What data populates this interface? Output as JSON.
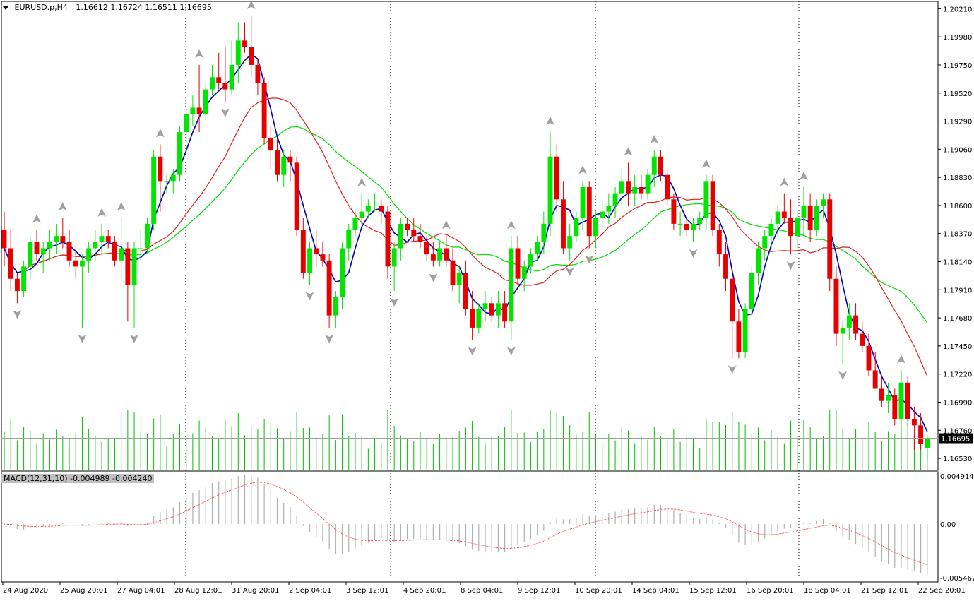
{
  "window": {
    "symbol": "EURUSD.p,H4",
    "ohlc": "1.16612 1.16724 1.16511 1.16695",
    "current_price_label": "1.16695"
  },
  "colors": {
    "bull": "#00e600",
    "bear": "#e60000",
    "fast_ma": "#0000b4",
    "slow_ma": "#e02020",
    "ma_green": "#00dd00",
    "volume": "#00c000",
    "fractal": "#a0a0a0",
    "macd_hist": "#b0b0b0",
    "macd_signal": "#ff3030"
  },
  "price_axis": {
    "ticks": [
      "1.20210",
      "1.19980",
      "1.19750",
      "1.19520",
      "1.19290",
      "1.19060",
      "1.18830",
      "1.18600",
      "1.18370",
      "1.18140",
      "1.17910",
      "1.17680",
      "1.17450",
      "1.17220",
      "1.16990",
      "1.16760",
      "1.16530"
    ]
  },
  "time_axis": {
    "labels": [
      "24 Aug 2020",
      "25 Aug 20:01",
      "27 Aug 04:01",
      "28 Aug 12:01",
      "31 Aug 20:01",
      "2 Sep 04:01",
      "3 Sep 12:01",
      "4 Sep 20:01",
      "8 Sep 04:01",
      "9 Sep 12:01",
      "10 Sep 20:01",
      "14 Sep 04:01",
      "15 Sep 12:01",
      "16 Sep 20:01",
      "18 Sep 04:01",
      "21 Sep 12:01",
      "22 Sep 20:01"
    ]
  },
  "macd": {
    "label": "MACD(12,31,10) -0.004989 -0.004240",
    "ticks": [
      "0.004914",
      "0.00",
      "-0.005462"
    ]
  },
  "chart_data": {
    "type": "candlestick",
    "price_range": [
      1.1645,
      1.2028
    ],
    "candles": [
      [
        1.184,
        1.1855,
        1.181,
        1.1825
      ],
      [
        1.1825,
        1.184,
        1.179,
        1.18
      ],
      [
        1.18,
        1.1805,
        1.178,
        1.179
      ],
      [
        1.179,
        1.1815,
        1.1785,
        1.181
      ],
      [
        1.181,
        1.1835,
        1.18,
        1.183
      ],
      [
        1.183,
        1.184,
        1.1815,
        1.182
      ],
      [
        1.182,
        1.183,
        1.1805,
        1.1825
      ],
      [
        1.1825,
        1.184,
        1.1815,
        1.183
      ],
      [
        1.183,
        1.1845,
        1.182,
        1.1835
      ],
      [
        1.1835,
        1.185,
        1.1825,
        1.183
      ],
      [
        1.183,
        1.184,
        1.181,
        1.1815
      ],
      [
        1.1815,
        1.1825,
        1.18,
        1.181
      ],
      [
        1.181,
        1.182,
        1.176,
        1.1815
      ],
      [
        1.1815,
        1.183,
        1.1805,
        1.1825
      ],
      [
        1.1825,
        1.184,
        1.1815,
        1.183
      ],
      [
        1.183,
        1.1845,
        1.182,
        1.1835
      ],
      [
        1.1835,
        1.184,
        1.1825,
        1.183
      ],
      [
        1.183,
        1.1835,
        1.181,
        1.1815
      ],
      [
        1.1815,
        1.185,
        1.18,
        1.1825
      ],
      [
        1.1825,
        1.183,
        1.1765,
        1.1795
      ],
      [
        1.1795,
        1.183,
        1.176,
        1.1825
      ],
      [
        1.1825,
        1.184,
        1.1815,
        1.1825
      ],
      [
        1.1825,
        1.185,
        1.182,
        1.1845
      ],
      [
        1.1845,
        1.1905,
        1.184,
        1.19
      ],
      [
        1.19,
        1.191,
        1.1855,
        1.188
      ],
      [
        1.188,
        1.1885,
        1.187,
        1.188
      ],
      [
        1.188,
        1.189,
        1.187,
        1.1885
      ],
      [
        1.1885,
        1.1925,
        1.188,
        1.192
      ],
      [
        1.192,
        1.194,
        1.1905,
        1.1935
      ],
      [
        1.1935,
        1.195,
        1.1925,
        1.194
      ],
      [
        1.194,
        1.1975,
        1.192,
        1.1935
      ],
      [
        1.1935,
        1.196,
        1.193,
        1.1955
      ],
      [
        1.1955,
        1.1975,
        1.195,
        1.1965
      ],
      [
        1.1965,
        1.1985,
        1.1955,
        1.196
      ],
      [
        1.196,
        1.199,
        1.1945,
        1.1955
      ],
      [
        1.1955,
        1.1995,
        1.195,
        1.1975
      ],
      [
        1.1975,
        1.201,
        1.196,
        1.1995
      ],
      [
        1.1995,
        1.201,
        1.1985,
        1.199
      ],
      [
        1.199,
        1.2015,
        1.1965,
        1.1975
      ],
      [
        1.1975,
        1.198,
        1.195,
        1.196
      ],
      [
        1.196,
        1.1965,
        1.191,
        1.1915
      ],
      [
        1.1915,
        1.1925,
        1.189,
        1.1905
      ],
      [
        1.1905,
        1.1915,
        1.188,
        1.1885
      ],
      [
        1.1885,
        1.1905,
        1.1875,
        1.19
      ],
      [
        1.19,
        1.1905,
        1.188,
        1.1895
      ],
      [
        1.1895,
        1.19,
        1.1835,
        1.184
      ],
      [
        1.184,
        1.185,
        1.18,
        1.1805
      ],
      [
        1.1805,
        1.183,
        1.1795,
        1.1825
      ],
      [
        1.1825,
        1.184,
        1.181,
        1.182
      ],
      [
        1.182,
        1.183,
        1.181,
        1.1815
      ],
      [
        1.1815,
        1.182,
        1.176,
        1.177
      ],
      [
        1.177,
        1.179,
        1.176,
        1.1785
      ],
      [
        1.1785,
        1.183,
        1.1775,
        1.1825
      ],
      [
        1.1825,
        1.1845,
        1.1815,
        1.184
      ],
      [
        1.184,
        1.1855,
        1.1835,
        1.185
      ],
      [
        1.185,
        1.187,
        1.1845,
        1.1855
      ],
      [
        1.1855,
        1.1865,
        1.185,
        1.186
      ],
      [
        1.186,
        1.187,
        1.1855,
        1.186
      ],
      [
        1.186,
        1.1865,
        1.1845,
        1.1855
      ],
      [
        1.1855,
        1.186,
        1.18,
        1.181
      ],
      [
        1.181,
        1.183,
        1.179,
        1.1825
      ],
      [
        1.1825,
        1.185,
        1.1815,
        1.1845
      ],
      [
        1.1845,
        1.185,
        1.1835,
        1.184
      ],
      [
        1.184,
        1.185,
        1.183,
        1.1835
      ],
      [
        1.1835,
        1.1845,
        1.1825,
        1.183
      ],
      [
        1.183,
        1.1835,
        1.1815,
        1.182
      ],
      [
        1.182,
        1.183,
        1.181,
        1.1815
      ],
      [
        1.1815,
        1.183,
        1.181,
        1.1825
      ],
      [
        1.1825,
        1.1835,
        1.181,
        1.1815
      ],
      [
        1.1815,
        1.1825,
        1.179,
        1.1795
      ],
      [
        1.1795,
        1.181,
        1.178,
        1.1805
      ],
      [
        1.1805,
        1.1815,
        1.177,
        1.1775
      ],
      [
        1.1775,
        1.179,
        1.175,
        1.176
      ],
      [
        1.176,
        1.178,
        1.1755,
        1.1775
      ],
      [
        1.1775,
        1.179,
        1.1765,
        1.178
      ],
      [
        1.178,
        1.1785,
        1.1765,
        1.177
      ],
      [
        1.177,
        1.179,
        1.176,
        1.178
      ],
      [
        1.178,
        1.179,
        1.176,
        1.1765
      ],
      [
        1.1765,
        1.1835,
        1.175,
        1.1825
      ],
      [
        1.1825,
        1.1835,
        1.1795,
        1.18
      ],
      [
        1.18,
        1.1815,
        1.179,
        1.181
      ],
      [
        1.181,
        1.1825,
        1.1805,
        1.182
      ],
      [
        1.182,
        1.1835,
        1.1815,
        1.183
      ],
      [
        1.183,
        1.1855,
        1.182,
        1.1845
      ],
      [
        1.1845,
        1.192,
        1.1835,
        1.19
      ],
      [
        1.19,
        1.191,
        1.1855,
        1.1865
      ],
      [
        1.1865,
        1.188,
        1.182,
        1.1825
      ],
      [
        1.1825,
        1.1845,
        1.1815,
        1.1835
      ],
      [
        1.1835,
        1.1855,
        1.183,
        1.185
      ],
      [
        1.185,
        1.188,
        1.184,
        1.1875
      ],
      [
        1.1875,
        1.188,
        1.1825,
        1.1835
      ],
      [
        1.1835,
        1.1855,
        1.1825,
        1.185
      ],
      [
        1.185,
        1.1865,
        1.184,
        1.1855
      ],
      [
        1.1855,
        1.187,
        1.1845,
        1.186
      ],
      [
        1.186,
        1.1875,
        1.185,
        1.187
      ],
      [
        1.187,
        1.189,
        1.186,
        1.188
      ],
      [
        1.188,
        1.1895,
        1.186,
        1.187
      ],
      [
        1.187,
        1.1885,
        1.186,
        1.1875
      ],
      [
        1.1875,
        1.1885,
        1.1865,
        1.187
      ],
      [
        1.187,
        1.189,
        1.1865,
        1.1885
      ],
      [
        1.1885,
        1.1905,
        1.1875,
        1.19
      ],
      [
        1.19,
        1.1905,
        1.188,
        1.1885
      ],
      [
        1.1885,
        1.189,
        1.186,
        1.1865
      ],
      [
        1.1865,
        1.187,
        1.184,
        1.1845
      ],
      [
        1.1845,
        1.1855,
        1.1835,
        1.1845
      ],
      [
        1.1845,
        1.185,
        1.1835,
        1.184
      ],
      [
        1.184,
        1.185,
        1.183,
        1.1845
      ],
      [
        1.1845,
        1.1855,
        1.184,
        1.185
      ],
      [
        1.185,
        1.1885,
        1.184,
        1.188
      ],
      [
        1.188,
        1.1885,
        1.1835,
        1.184
      ],
      [
        1.184,
        1.1845,
        1.181,
        1.182
      ],
      [
        1.182,
        1.183,
        1.179,
        1.18
      ],
      [
        1.18,
        1.1805,
        1.1735,
        1.1765
      ],
      [
        1.1765,
        1.1775,
        1.1735,
        1.174
      ],
      [
        1.174,
        1.178,
        1.1735,
        1.1775
      ],
      [
        1.1775,
        1.181,
        1.177,
        1.1805
      ],
      [
        1.1805,
        1.183,
        1.1795,
        1.1825
      ],
      [
        1.1825,
        1.184,
        1.1815,
        1.1835
      ],
      [
        1.1835,
        1.185,
        1.1825,
        1.1845
      ],
      [
        1.1845,
        1.186,
        1.1835,
        1.1855
      ],
      [
        1.1855,
        1.187,
        1.1845,
        1.185
      ],
      [
        1.185,
        1.1865,
        1.182,
        1.1835
      ],
      [
        1.1835,
        1.1855,
        1.1825,
        1.185
      ],
      [
        1.185,
        1.1875,
        1.1835,
        1.186
      ],
      [
        1.186,
        1.187,
        1.183,
        1.184
      ],
      [
        1.184,
        1.1865,
        1.1835,
        1.186
      ],
      [
        1.186,
        1.187,
        1.185,
        1.1865
      ],
      [
        1.1865,
        1.187,
        1.179,
        1.18
      ],
      [
        1.18,
        1.181,
        1.1745,
        1.1755
      ],
      [
        1.1755,
        1.1765,
        1.173,
        1.176
      ],
      [
        1.176,
        1.178,
        1.175,
        1.177
      ],
      [
        1.177,
        1.178,
        1.175,
        1.1755
      ],
      [
        1.1755,
        1.1765,
        1.174,
        1.1745
      ],
      [
        1.1745,
        1.1755,
        1.172,
        1.1725
      ],
      [
        1.1725,
        1.174,
        1.171,
        1.171
      ],
      [
        1.171,
        1.172,
        1.1695,
        1.17
      ],
      [
        1.17,
        1.1715,
        1.169,
        1.1705
      ],
      [
        1.1705,
        1.171,
        1.168,
        1.1685
      ],
      [
        1.1685,
        1.1725,
        1.1675,
        1.1715
      ],
      [
        1.1715,
        1.172,
        1.168,
        1.1685
      ],
      [
        1.1685,
        1.1695,
        1.166,
        1.168
      ],
      [
        1.168,
        1.169,
        1.166,
        1.1665
      ],
      [
        1.16612,
        1.16724,
        1.16511,
        1.16695
      ]
    ]
  }
}
